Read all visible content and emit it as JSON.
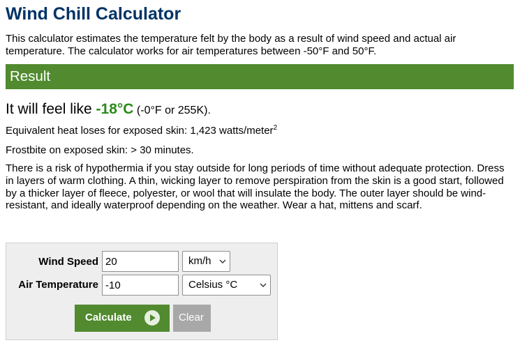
{
  "page": {
    "title": "Wind Chill Calculator",
    "intro": "This calculator estimates the temperature felt by the body as a result of wind speed and actual air temperature. The calculator works for air temperatures between -50°F and 50°F."
  },
  "result": {
    "heading": "Result",
    "feel_prefix": "It will feel like ",
    "feel_value": "-18°C",
    "feel_alt": " (-0°F or 255K).",
    "heat_loss_text": "Equivalent heat loses for exposed skin: 1,423 watts/meter",
    "heat_loss_exponent": "2",
    "frostbite_text": "Frostbite on exposed skin: > 30 minutes.",
    "advice": "There is a risk of hypothermia if you stay outside for long periods of time without adequate protection. Dress in layers of warm clothing. A thin, wicking layer to remove perspiration from the skin is a good start, followed by a thicker layer of fleece, polyester, or wool that will insulate the body. The outer layer should be wind-resistant, and ideally waterproof depending on the weather. Wear a hat, mittens and scarf."
  },
  "form": {
    "wind_speed_label": "Wind Speed",
    "wind_speed_value": "20",
    "wind_speed_unit": "km/h",
    "air_temp_label": "Air Temperature",
    "air_temp_value": "-10",
    "air_temp_unit": "Celsius °C",
    "calculate_label": "Calculate",
    "clear_label": "Clear"
  },
  "colors": {
    "title": "#003366",
    "accent_green": "#518a2f",
    "result_green": "#2b8a1a",
    "clear_gray": "#a8a8a8"
  },
  "icons": {
    "calculate": "play-circle-icon",
    "select": "chevron-down-icon"
  }
}
